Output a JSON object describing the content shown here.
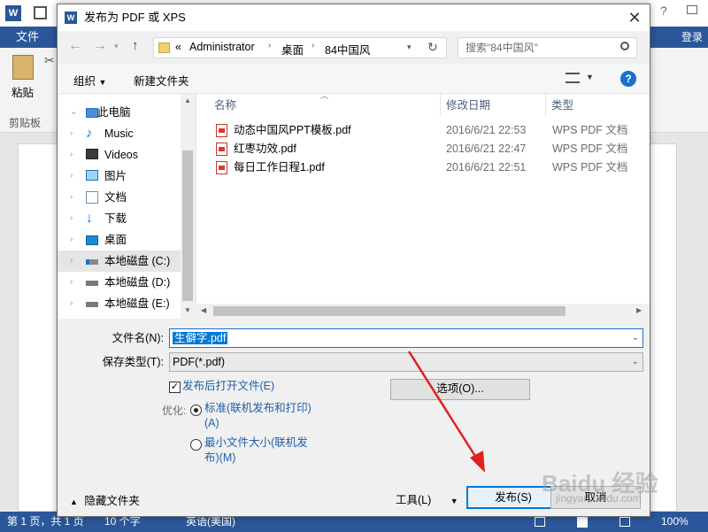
{
  "word": {
    "file_tab": "文件",
    "login": "登录",
    "paste": "粘贴",
    "clipboard": "剪贴板",
    "status": "第 1 页，共 1 页",
    "words": "10 个字",
    "language": "英语(美国)",
    "zoom": "100%"
  },
  "dialog": {
    "title": "发布为 PDF 或 XPS",
    "breadcrumb": {
      "overflow": "«",
      "items": [
        "Administrator",
        "桌面",
        "84中国风"
      ]
    },
    "search_placeholder": "搜索\"84中国风\"",
    "toolbar": {
      "organize": "组织",
      "new_folder": "新建文件夹"
    },
    "nav_items": [
      {
        "label": "此电脑",
        "icon": "computer-icon"
      },
      {
        "label": "Music",
        "icon": "music-icon"
      },
      {
        "label": "Videos",
        "icon": "videos-icon"
      },
      {
        "label": "图片",
        "icon": "pictures-icon"
      },
      {
        "label": "文档",
        "icon": "documents-icon"
      },
      {
        "label": "下载",
        "icon": "downloads-icon"
      },
      {
        "label": "桌面",
        "icon": "desktop-icon"
      },
      {
        "label": "本地磁盘 (C:)",
        "icon": "drive-c-icon"
      },
      {
        "label": "本地磁盘 (D:)",
        "icon": "drive-icon"
      },
      {
        "label": "本地磁盘 (E:)",
        "icon": "drive-icon"
      }
    ],
    "columns": {
      "name": "名称",
      "date": "修改日期",
      "type": "类型"
    },
    "files": [
      {
        "name": "动态中国风PPT模板.pdf",
        "date": "2016/6/21 22:53",
        "type": "WPS PDF 文档"
      },
      {
        "name": "红枣功效.pdf",
        "date": "2016/6/21 22:47",
        "type": "WPS PDF 文档"
      },
      {
        "name": "每日工作日程1.pdf",
        "date": "2016/6/21 22:51",
        "type": "WPS PDF 文档"
      }
    ],
    "filename_label": "文件名(N):",
    "filename_value": "生僻字.pdf",
    "filetype_label": "保存类型(T):",
    "filetype_value": "PDF(*.pdf)",
    "open_after_publish": "发布后打开文件(E)",
    "open_after_checked": true,
    "options_button": "选项(O)...",
    "optimize_label": "优化:",
    "optimize_standard_1": "标准(联机发布和打印)",
    "optimize_standard_2": "(A)",
    "optimize_min_1": "最小文件大小(联机发",
    "optimize_min_2": "布)(M)",
    "optimize_selected": "standard",
    "hide_folders": "隐藏文件夹",
    "tools": "工具(L)",
    "publish": "发布(S)",
    "cancel": "取消"
  },
  "watermark": {
    "logo": "Baidu 经验",
    "url": "jingyan.baidu.com"
  },
  "colors": {
    "word_blue": "#2b579a",
    "accent_blue": "#0078d7",
    "arrow_red": "#e02020"
  }
}
